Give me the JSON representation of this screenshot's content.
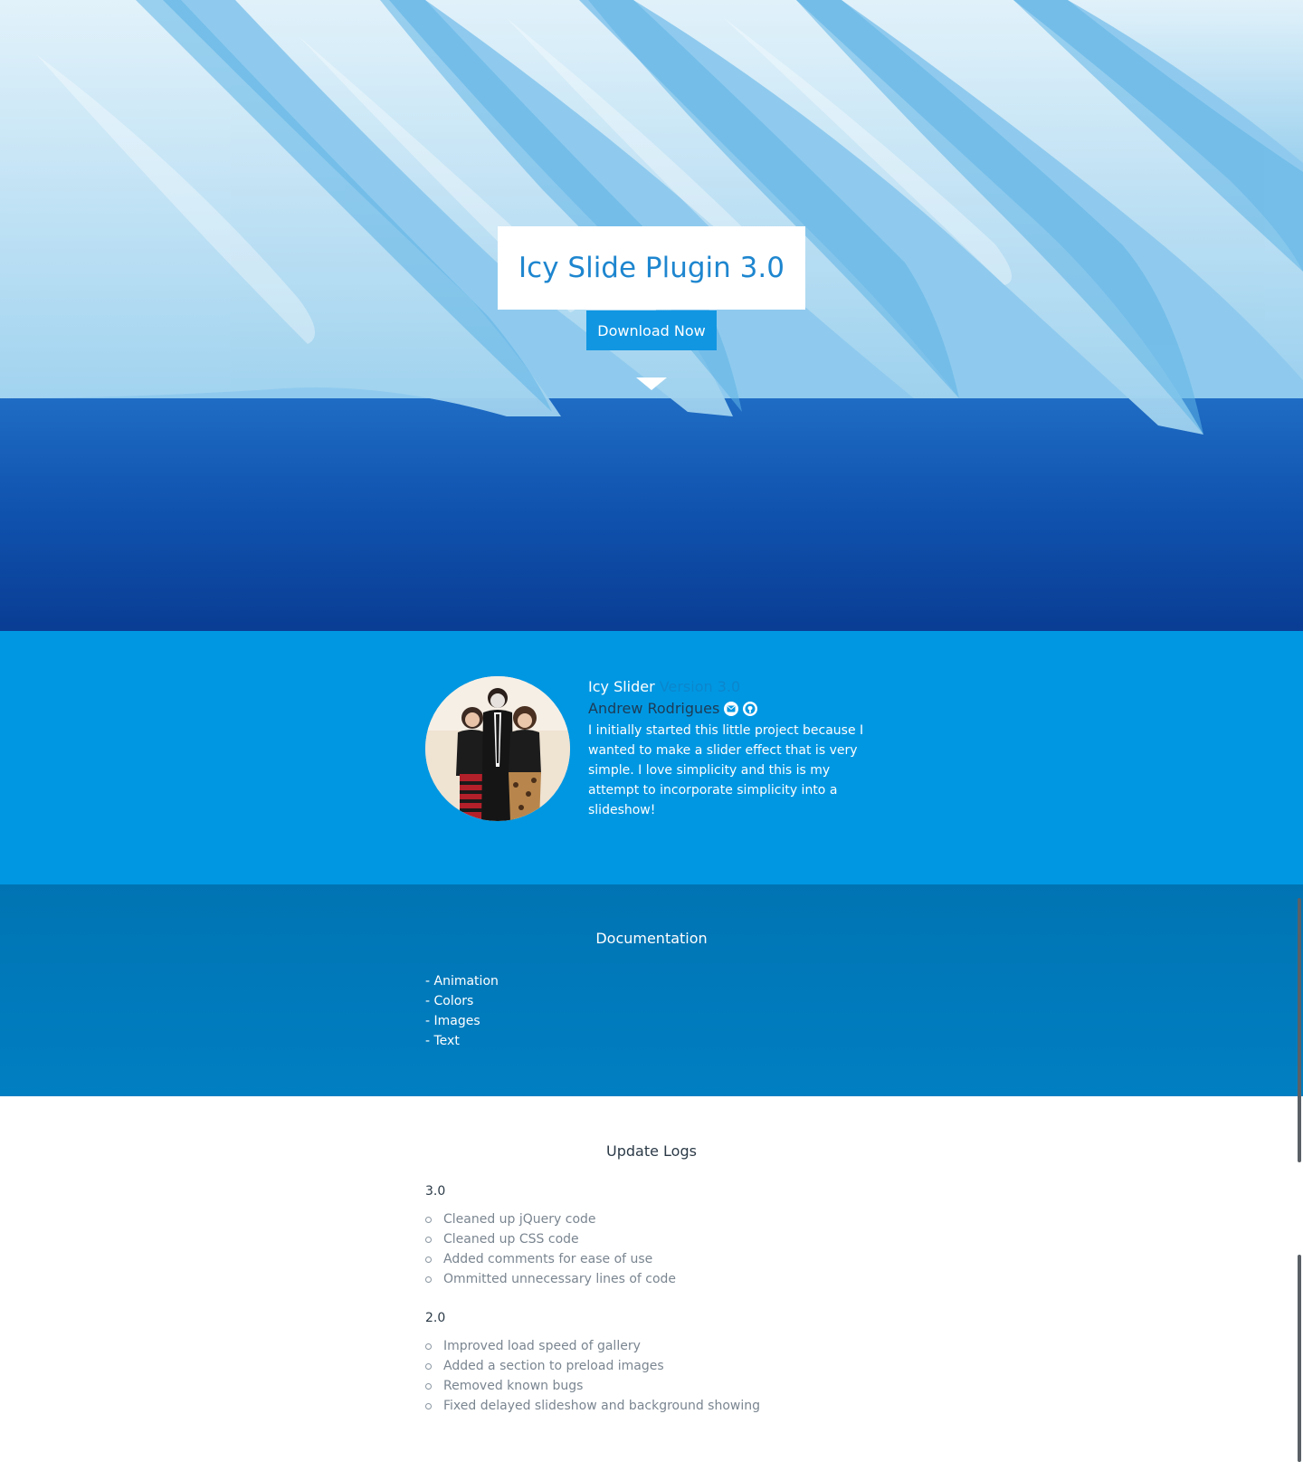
{
  "hero": {
    "title": "Icy Slide Plugin 3.0",
    "download_label": "Download Now"
  },
  "about": {
    "name": "Icy Slider",
    "version": "Version 3.0",
    "author": "Andrew Rodrigues",
    "description": "I initially started this little project because I wanted to make a slider effect that is very simple. I love simplicity and this is my attempt to incorporate simplicity into a slideshow!",
    "icons": [
      "mail-icon",
      "github-icon"
    ]
  },
  "docs": {
    "title": "Documentation",
    "items": [
      "- Animation",
      "- Colors",
      "- Images",
      "- Text"
    ]
  },
  "logs": {
    "title": "Update Logs",
    "entries": [
      {
        "version": "3.0",
        "items": [
          "Cleaned up jQuery code",
          "Cleaned up CSS code",
          "Added comments for ease of use",
          "Ommitted unnecessary lines of code"
        ]
      },
      {
        "version": "2.0",
        "items": [
          "Improved load speed of gallery",
          "Added a section to preload images",
          "Removed known bugs",
          "Fixed delayed slideshow and background showing"
        ]
      }
    ]
  },
  "colors": {
    "brand_blue": "#0097e2",
    "docs_blue": "#007fc2",
    "title_blue": "#1e86cf",
    "button_blue": "#1196e2"
  }
}
